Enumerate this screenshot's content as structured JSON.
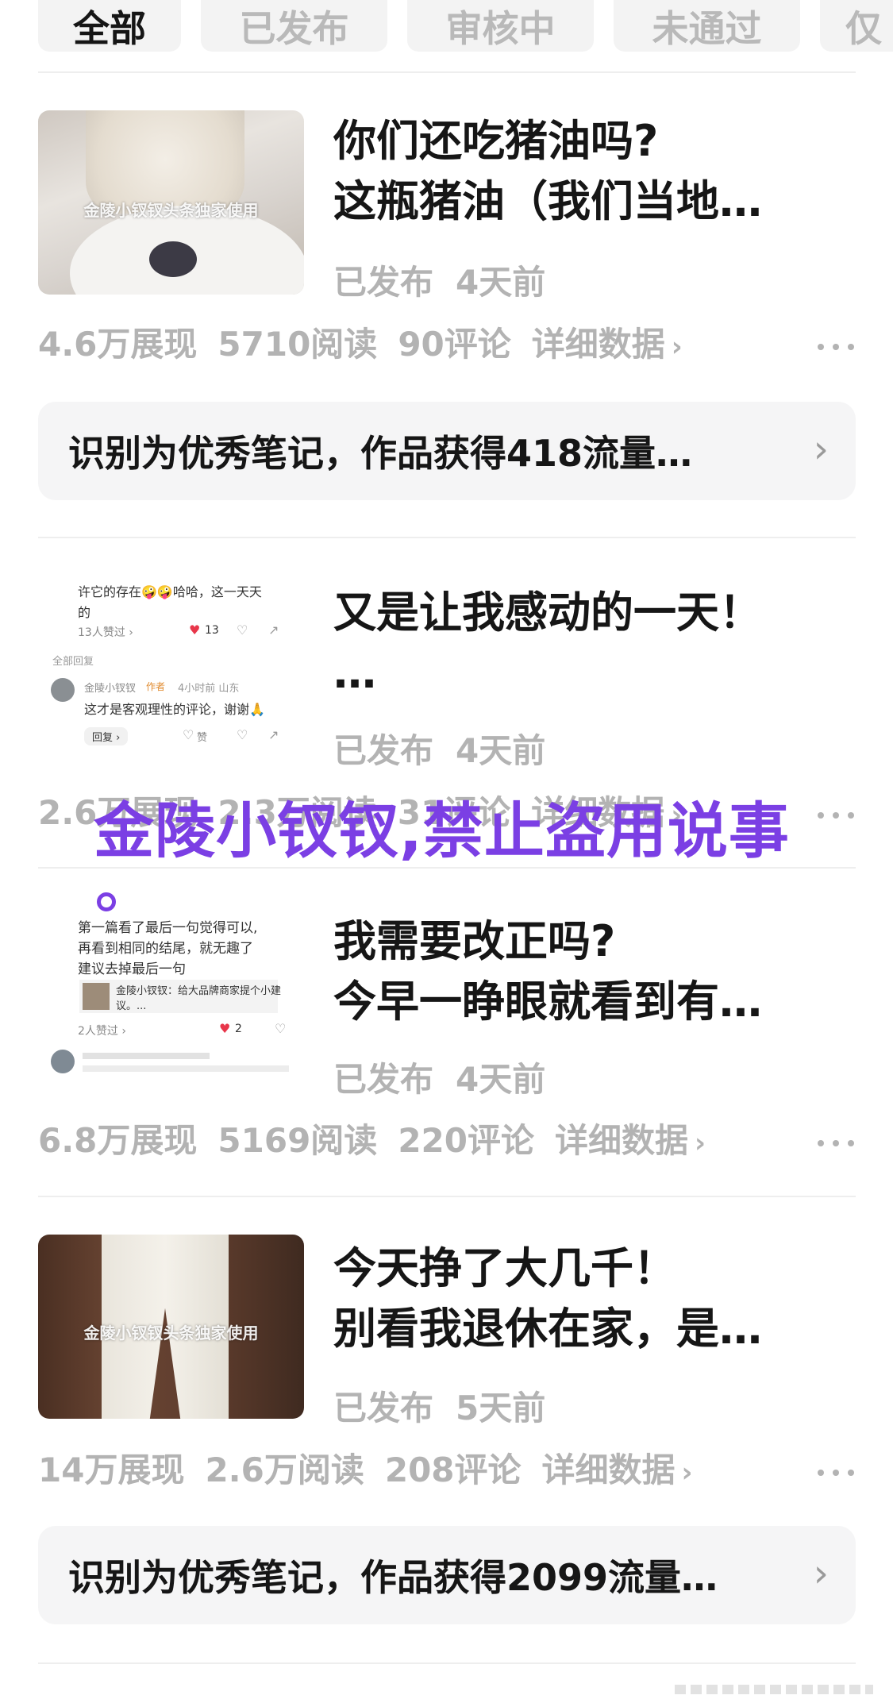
{
  "tabs": [
    {
      "label": "全部",
      "active": true
    },
    {
      "label": "已发布",
      "active": false
    },
    {
      "label": "审核中",
      "active": false
    },
    {
      "label": "未通过",
      "active": false
    },
    {
      "label": "仅",
      "active": false
    }
  ],
  "posts": [
    {
      "title_line1": "你们还吃猪油吗?",
      "title_line2": "这瓶猪油（我们当地…",
      "status": "已发布",
      "time": "4天前",
      "thumb_watermark": "金陵小钗钗头条独家使用",
      "stats": {
        "impressions": "4.6万展现",
        "reads": "5710阅读",
        "comments": "90评论",
        "detail": "详细数据"
      },
      "notice": "识别为优秀笔记，作品获得418流量…"
    },
    {
      "title_line1": "又是让我感动的一天！",
      "title_line2": "…",
      "status": "已发布",
      "time": "4天前",
      "stats": {
        "impressions": "2.6万展现",
        "reads": "2.3万阅读",
        "comments": "31评论",
        "detail": "详细数据"
      },
      "thumb_texts": {
        "line1": "许它的存在🤪🤪哈哈，这一天天",
        "line2": "的",
        "likes_text": "13人赞过 ›",
        "heart_count": "13",
        "all_replies": "全部回复",
        "author": "金陵小钗钗",
        "author_badge": "作者",
        "meta": "4小时前 山东",
        "reply": "这才是客观理性的评论，谢谢🙏",
        "reply_button": "回复 ›",
        "like_label": "赞"
      }
    },
    {
      "title_line1": "我需要改正吗?",
      "title_line2": "今早一睁眼就看到有…",
      "status": "已发布",
      "time": "4天前",
      "stats": {
        "impressions": "6.8万展现",
        "reads": "5169阅读",
        "comments": "220评论",
        "detail": "详细数据"
      },
      "thumb_texts": {
        "line1": "第一篇看了最后一句觉得可以,",
        "line2": "再看到相同的结尾，就无趣了",
        "line3": "建议去掉最后一句",
        "quote": "金陵小钗钗：给大品牌商家提个小建",
        "quote2": "议。...",
        "likes_text": "2人赞过 ›",
        "heart_count": "2"
      }
    },
    {
      "title_line1": "今天挣了大几千！",
      "title_line2": "别看我退休在家，是…",
      "status": "已发布",
      "time": "5天前",
      "thumb_watermark": "金陵小钗钗头条独家使用",
      "stats": {
        "impressions": "14万展现",
        "reads": "2.6万阅读",
        "comments": "208评论",
        "detail": "详细数据"
      },
      "notice": "识别为优秀笔记，作品获得2099流量…"
    }
  ],
  "watermark": "金陵小钗钗,禁止盗用说事",
  "colors": {
    "watermark": "#7b3fe4",
    "heart": "#e8364a",
    "muted": "#b3b3b3"
  }
}
